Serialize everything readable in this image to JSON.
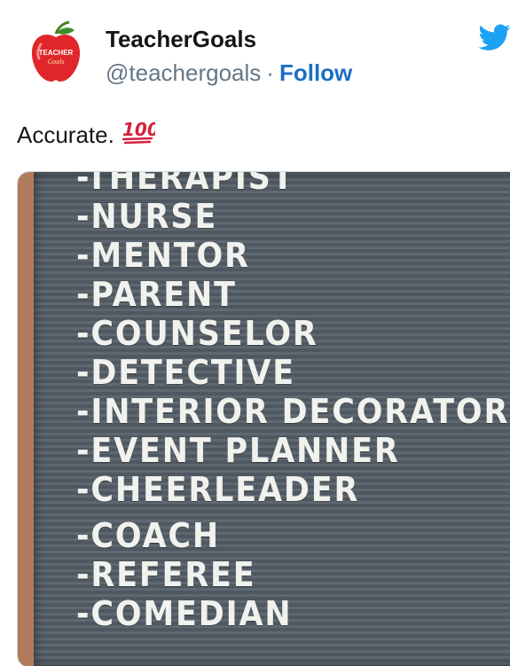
{
  "author": {
    "name": "TeacherGoals",
    "handle": "@teachergoals",
    "separator": "·",
    "follow_label": "Follow",
    "avatar_text_line1": "TEACHER",
    "avatar_text_line2": "Goals"
  },
  "tweet": {
    "text": "Accurate.",
    "emoji_text": "100"
  },
  "media": {
    "lines": [
      "-THERAPIST",
      "-NURSE",
      "-MENTOR",
      "-PARENT",
      "-COUNSELOR",
      "-DETECTIVE",
      "-INTERIOR DECORATOR",
      "-EVENT PLANNER",
      "-CHEERLEADER",
      "-COACH",
      "-REFEREE",
      "-COMEDIAN"
    ]
  },
  "colors": {
    "follow": "#1b6ec2",
    "twitter_blue": "#1da1f2",
    "board": "#5a646c",
    "apple_red": "#e0262b"
  },
  "icons": {
    "platform": "twitter-bird-icon",
    "emoji": "hundred-points-icon"
  }
}
